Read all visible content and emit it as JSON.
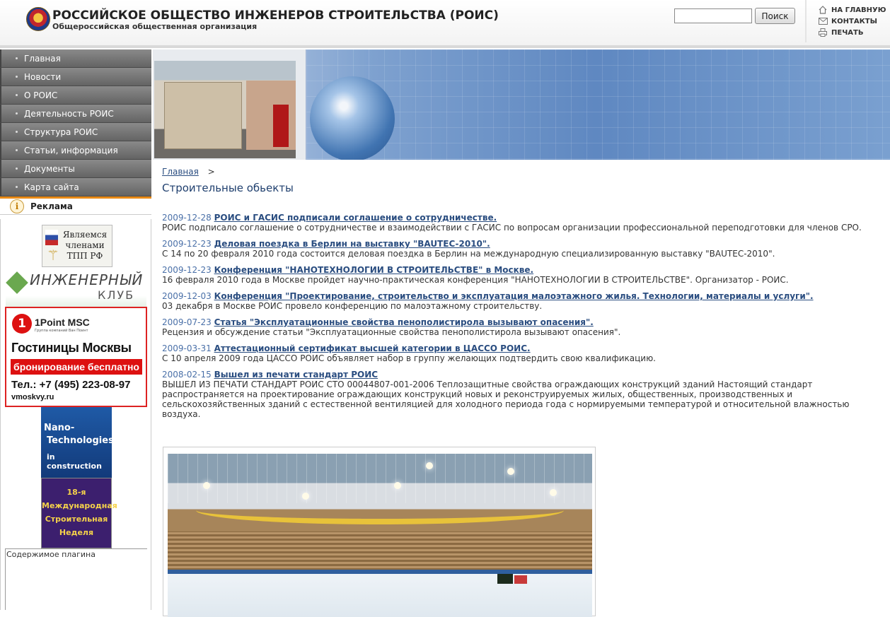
{
  "header": {
    "title": "РОССИЙСКОЕ ОБЩЕСТВО ИНЖЕНЕРОВ СТРОИТЕЛЬСТВА (РОИС)",
    "subtitle": "Общероссийская общественная организация",
    "search_button": "Поиск",
    "search_value": "",
    "links": [
      {
        "label": "НА ГЛАВНУЮ",
        "icon": "home-icon"
      },
      {
        "label": "КОНТАКТЫ",
        "icon": "mail-icon"
      },
      {
        "label": "ПЕЧАТЬ",
        "icon": "print-icon"
      }
    ]
  },
  "sidebar": {
    "menu": [
      "Главная",
      "Новости",
      "О РОИС",
      "Деятельность РОИС",
      "Структура РОИС",
      "Статьи, информация",
      "Документы",
      "Карта сайта"
    ],
    "ads_title": "Реклама",
    "ads": {
      "tpp": "Являемся членами ТПП РФ",
      "club_1": "ИНЖЕНЕРНЫЙ",
      "club_2": "КЛУБ",
      "hotel_number": "1",
      "hotel_brand": "1Point MSC",
      "hotel_brand_sub": "Группа компаний Ван Поинт",
      "hotel_1": "Гостиницы Москвы",
      "hotel_2": "бронирование бесплатно",
      "hotel_3": "Тел.: +7 (495) 223-08-97",
      "hotel_4": "vmoskvy.ru",
      "nano_1": "Nano-",
      "nano_2": "Technologies",
      "nano_3": "in construction",
      "week": "18-я Международная Строительная Неделя"
    },
    "plugin_text": "Содержимое плагина"
  },
  "content": {
    "breadcrumb_home": "Главная",
    "breadcrumb_sep": ">",
    "page_title": "Строительные обьекты",
    "news": [
      {
        "date": "2009-12-28",
        "title": "РОИС и ГАСИС подписали соглашение о сотрудничестве.",
        "desc": "РОИС подписало соглашение о сотрудничестве и взаимодействии с ГАСИС по вопросам организации профессиональной переподготовки для членов СРО."
      },
      {
        "date": "2009-12-23",
        "title": "Деловая поездка в Берлин на выставку \"BAUTEC-2010\".",
        "desc": "С 14 по 20 февраля 2010 года состоится деловая поездка в Берлин на международную специализированную выставку \"BAUTEC-2010\"."
      },
      {
        "date": "2009-12-23",
        "title": "Конференция \"НАНОТЕХНОЛОГИИ В СТРОИТЕЛЬСТВЕ\" в Москве.",
        "desc": "16 февраля 2010 года в Москве пройдет научно-практическая конференция \"НАНОТЕХНОЛОГИИ В СТРОИТЕЛЬСТВЕ\". Организатор - РОИС."
      },
      {
        "date": "2009-12-03",
        "title": "Конференция \"Проектирование, строительство и эксплуатация малоэтажного жилья. Технологии, материалы и услуги\".",
        "desc": "03 декабря в Москве РОИС провело конференцию по малоэтажному строительству."
      },
      {
        "date": "2009-07-23",
        "title": "Статья \"Эксплуатационные свойства пенополистирола вызывают опасения\".",
        "desc": "Рецензия и обсуждение статьи \"Эксплуатационные свойства пенополистирола вызывают опасения\"."
      },
      {
        "date": "2009-03-31",
        "title": "Аттестационный сертификат высшей категории в ЦАССО РОИС.",
        "desc": "С 10 апреля 2009 года ЦАССО РОИС объявляет набор в группу желающих подтвердить свою квалификацию."
      },
      {
        "date": "2008-02-15",
        "title": "Вышел из печати стандарт РОИС",
        "desc": "ВЫШЕЛ ИЗ ПЕЧАТИ СТАНДАРТ РОИС СТО 00044807-001-2006 Теплозащитные свойства ограждающих конструкций зданий Настоящий стандарт распространяется на проектирование ограждающих конструкций новых и реконструируемых жилых, общественных, производственных и сельскохозяйственных зданий с естественной вентиляцией для холодного периода года с нормируемыми температурой и относительной влажностью воздуха."
      }
    ]
  },
  "colors": {
    "accent": "#2a4d80",
    "menu": "#7a7a7a",
    "ads_border": "#e98a16",
    "banner": "#5f88c1"
  }
}
